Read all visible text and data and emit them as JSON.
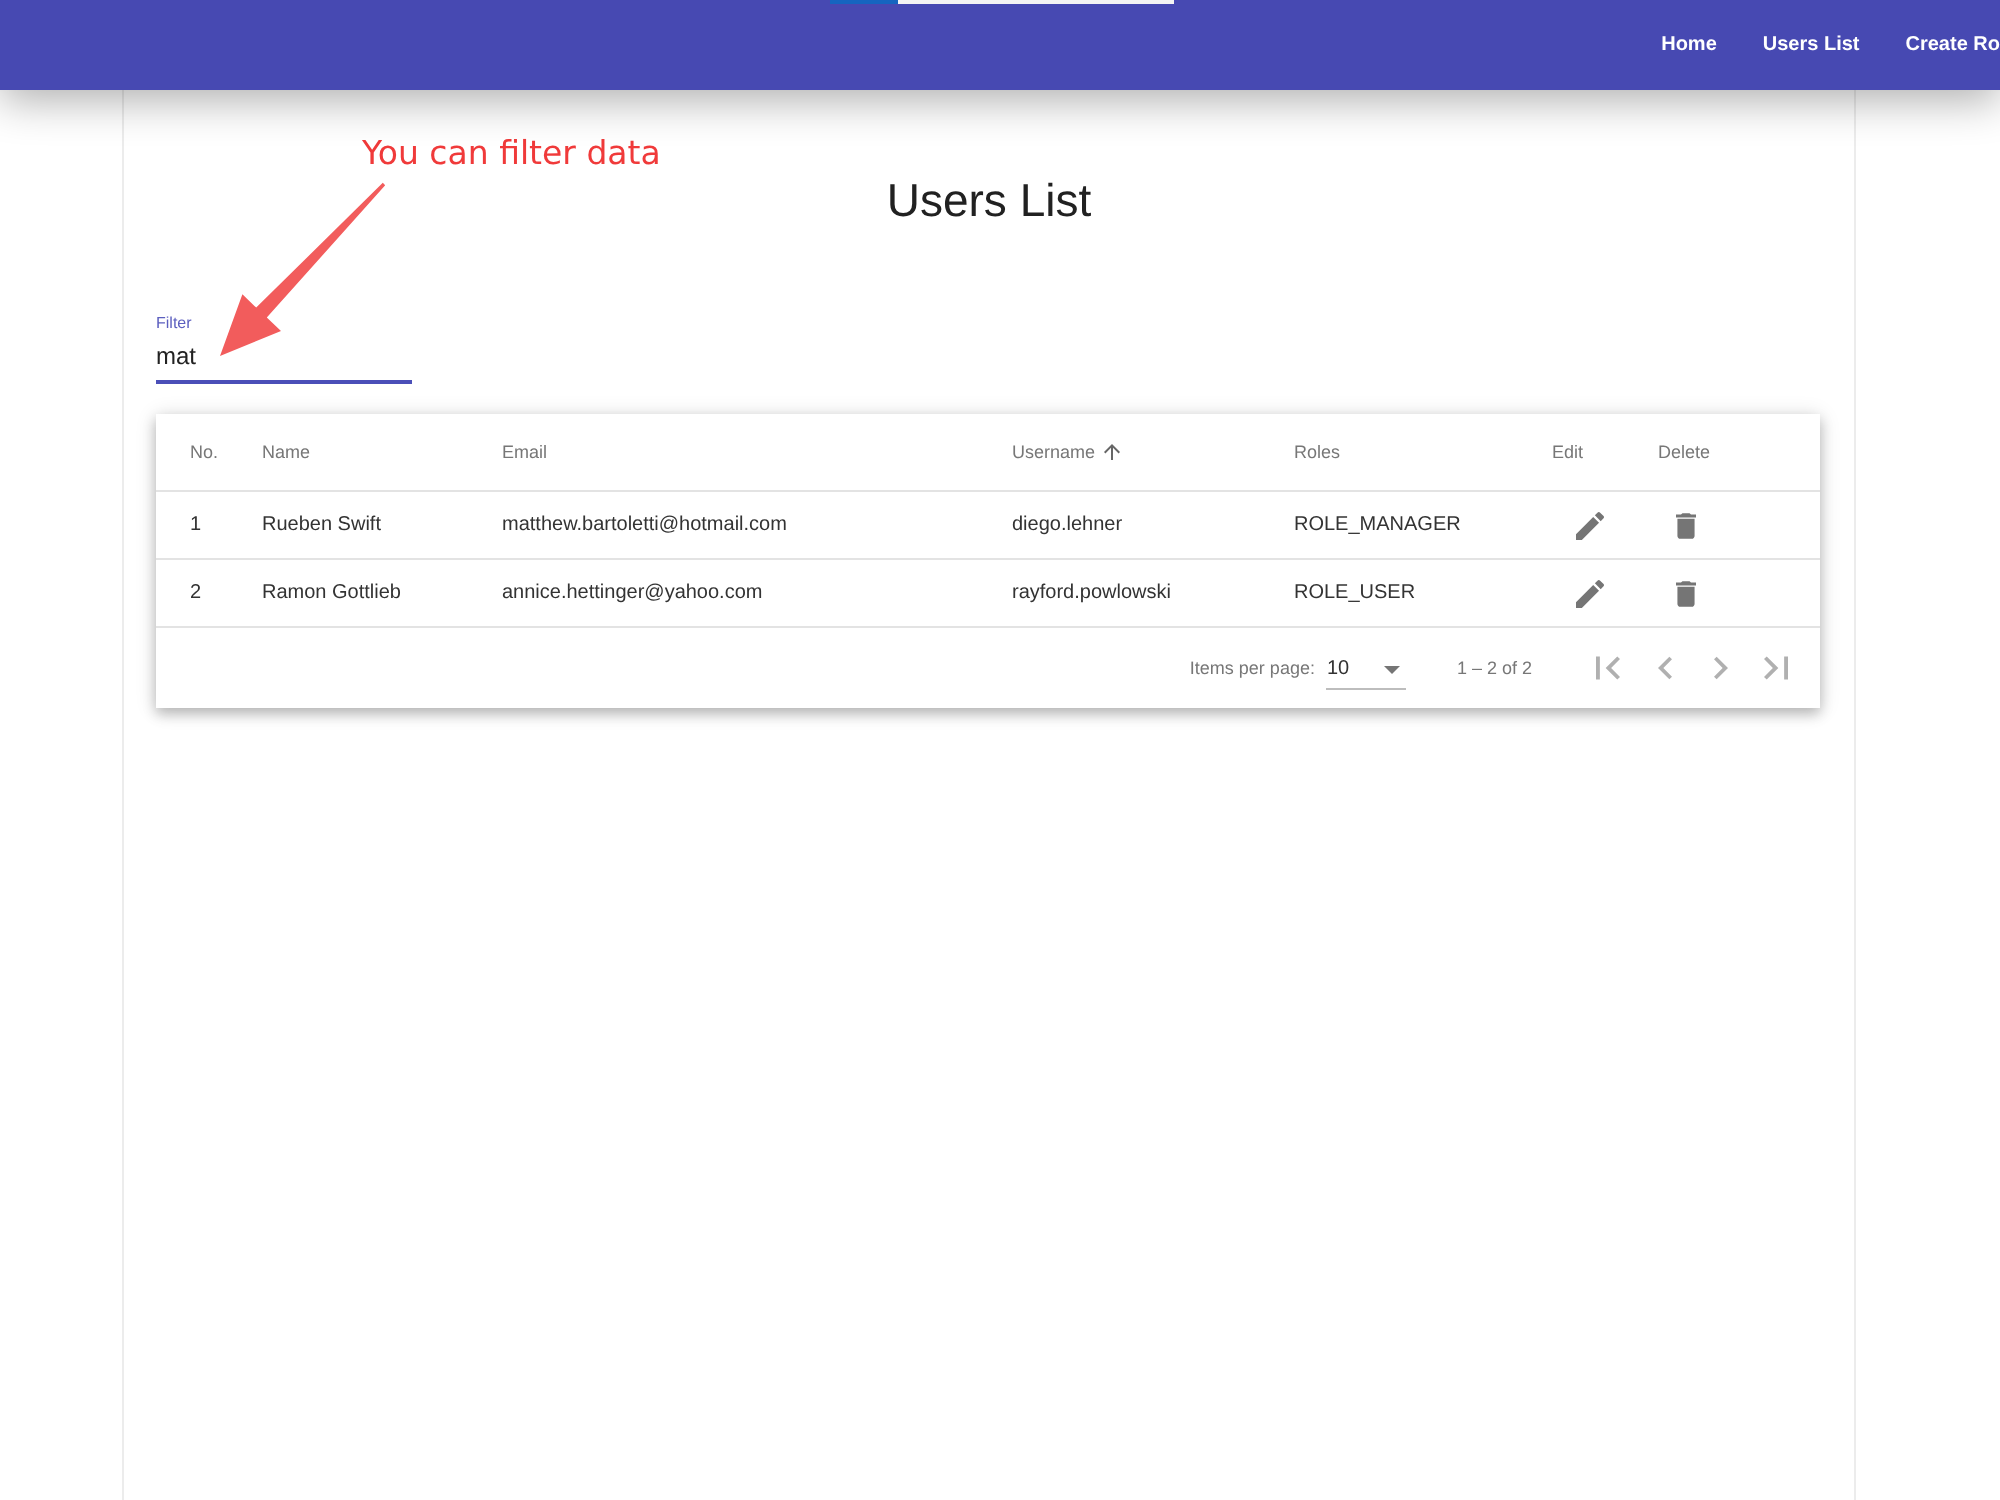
{
  "header": {
    "nav": [
      {
        "label": "Home"
      },
      {
        "label": "Users List"
      },
      {
        "label": "Create Ro"
      }
    ]
  },
  "annotation": {
    "text": "You can filter data"
  },
  "page": {
    "title": "Users List"
  },
  "filter": {
    "label": "Filter",
    "value": "mat",
    "focused": true
  },
  "table": {
    "columns": [
      {
        "label": "No.",
        "kind": "text",
        "sorted": false
      },
      {
        "label": "Name",
        "kind": "text",
        "sorted": false
      },
      {
        "label": "Email",
        "kind": "text",
        "sorted": false
      },
      {
        "label": "Username",
        "kind": "text",
        "sorted": true
      },
      {
        "label": "Roles",
        "kind": "text",
        "sorted": false
      },
      {
        "label": "Edit",
        "kind": "edit",
        "sorted": false
      },
      {
        "label": "Delete",
        "kind": "delete",
        "sorted": false
      }
    ],
    "rows": [
      {
        "cells": [
          "1",
          "Rueben Swift",
          "matthew.bartoletti@hotmail.com",
          "diego.lehner",
          "ROLE_MANAGER"
        ]
      },
      {
        "cells": [
          "2",
          "Ramon Gottlieb",
          "annice.hettinger@yahoo.com",
          "rayford.powlowski",
          "ROLE_USER"
        ]
      }
    ]
  },
  "paginator": {
    "label": "Items per page:",
    "page_size": "10",
    "range": "1 – 2 of 2",
    "buttons": [
      {
        "kind": "first",
        "disabled": true
      },
      {
        "kind": "previous",
        "disabled": true
      },
      {
        "kind": "next",
        "disabled": true
      },
      {
        "kind": "last",
        "disabled": true
      }
    ]
  }
}
